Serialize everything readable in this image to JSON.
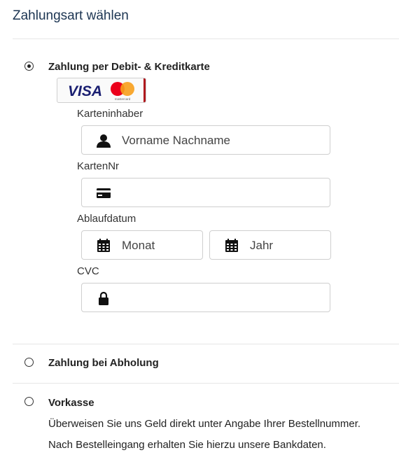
{
  "header": {
    "title": "Zahlungsart wählen"
  },
  "payment_options": [
    {
      "label": "Zahlung per Debit- & Kreditkarte",
      "selected": true,
      "card_logos": [
        "VISA",
        "mastercard"
      ],
      "fields": {
        "cardholder": {
          "label": "Karteninhaber",
          "placeholder": "Vorname Nachname",
          "icon": "user-icon"
        },
        "card_number": {
          "label": "KartenNr",
          "placeholder": "",
          "icon": "credit-card-icon"
        },
        "expiry": {
          "label": "Ablaufdatum",
          "month_placeholder": "Monat",
          "year_placeholder": "Jahr",
          "icon": "calendar-icon"
        },
        "cvc": {
          "label": "CVC",
          "placeholder": "",
          "icon": "lock-icon"
        }
      }
    },
    {
      "label": "Zahlung bei Abholung",
      "selected": false
    },
    {
      "label": "Vorkasse",
      "selected": false,
      "description": [
        "Überweisen Sie uns Geld direkt unter Angabe Ihrer Bestellnummer.",
        "Nach Bestelleingang erhalten Sie hierzu unsere Bankdaten."
      ]
    }
  ],
  "colors": {
    "title": "#1c3552",
    "border": "#cfcfcf",
    "mastercard_red": "#eb001b",
    "mastercard_orange": "#f79e1b",
    "visa_blue": "#1a1f71"
  }
}
